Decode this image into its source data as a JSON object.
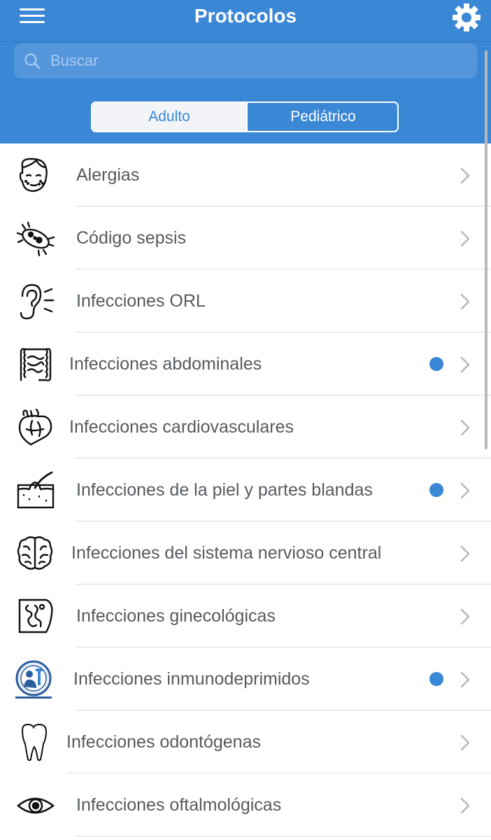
{
  "header": {
    "title": "Protocolos",
    "menu_icon": "hamburger-menu-icon",
    "settings_icon": "gear-icon"
  },
  "search": {
    "placeholder": "Buscar",
    "icon": "search-icon"
  },
  "segmented": {
    "options": [
      "Adulto",
      "Pediátrico"
    ],
    "selected": "Adulto"
  },
  "colors": {
    "header_bg": "#3a87d6",
    "accent": "#3a87d6",
    "dot": "#3a87d6",
    "text": "#555a5f"
  },
  "protocols": [
    {
      "label": "Alergias",
      "icon": "allergy-face-icon",
      "new": false
    },
    {
      "label": "Código sepsis",
      "icon": "bacteria-icon",
      "new": false
    },
    {
      "label": "Infecciones ORL",
      "icon": "ear-icon",
      "new": false
    },
    {
      "label": "Infecciones abdominales",
      "icon": "intestine-icon",
      "new": true
    },
    {
      "label": "Infecciones cardiovasculares",
      "icon": "heart-icon",
      "new": false
    },
    {
      "label": "Infecciones de la piel y partes blandas",
      "icon": "skin-hair-icon",
      "new": true
    },
    {
      "label": "Infecciones del sistema nervioso central",
      "icon": "brain-icon",
      "new": false
    },
    {
      "label": "Infecciones ginecológicas",
      "icon": "uterus-icon",
      "new": false
    },
    {
      "label": "Infecciones inmunodeprimidos",
      "icon": "immunocompromised-patient-icon",
      "new": true
    },
    {
      "label": "Infecciones odontógenas",
      "icon": "tooth-icon",
      "new": false
    },
    {
      "label": "Infecciones oftalmológicas",
      "icon": "eye-icon",
      "new": false
    }
  ]
}
